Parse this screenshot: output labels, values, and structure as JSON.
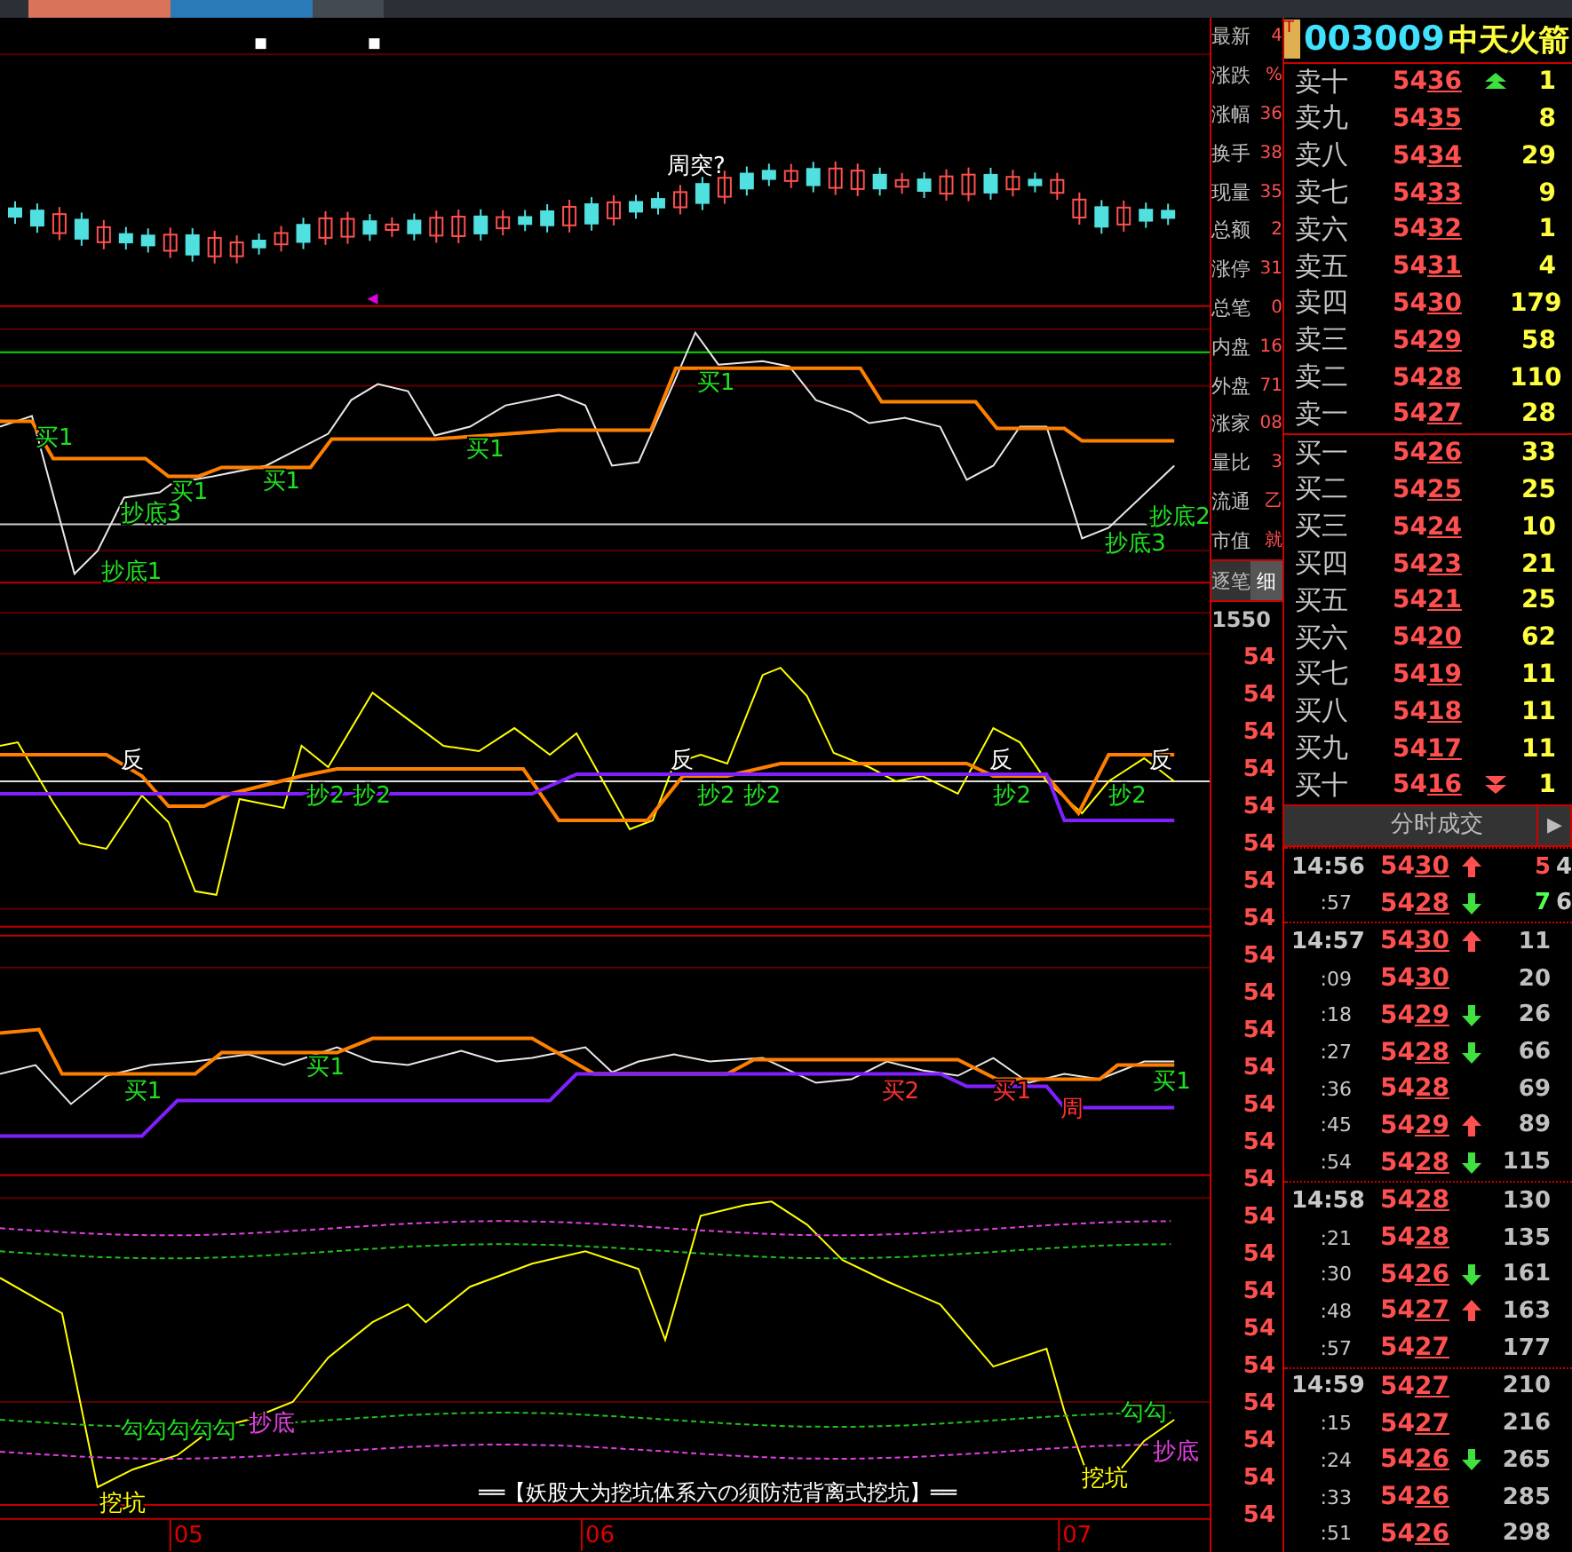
{
  "stock": {
    "badge": "T",
    "code": "003009",
    "name": "中天火箭"
  },
  "chart_panels": [
    {
      "labels": [
        {
          "text": "周突?",
          "kind": "note"
        }
      ]
    },
    {
      "labels": [
        {
          "text": "买1",
          "kind": "buy"
        },
        {
          "text": "买1",
          "kind": "buy"
        },
        {
          "text": "买1",
          "kind": "buy"
        },
        {
          "text": "买1",
          "kind": "buy"
        },
        {
          "text": "买1",
          "kind": "buy"
        },
        {
          "text": "抄底3",
          "kind": "buy"
        },
        {
          "text": "抄底1",
          "kind": "buy"
        },
        {
          "text": "抄底3",
          "kind": "buy"
        },
        {
          "text": "抄底2",
          "kind": "buy"
        }
      ]
    },
    {
      "labels": [
        {
          "text": "反",
          "kind": "note"
        },
        {
          "text": "抄2",
          "kind": "buy"
        },
        {
          "text": "抄2",
          "kind": "buy"
        },
        {
          "text": "反",
          "kind": "note"
        },
        {
          "text": "抄2",
          "kind": "buy"
        },
        {
          "text": "抄2",
          "kind": "buy"
        },
        {
          "text": "反",
          "kind": "note"
        },
        {
          "text": "抄2",
          "kind": "buy"
        },
        {
          "text": "抄2",
          "kind": "buy"
        },
        {
          "text": "反",
          "kind": "note"
        }
      ]
    },
    {
      "labels": [
        {
          "text": "买1",
          "kind": "buy"
        },
        {
          "text": "买1",
          "kind": "buy"
        },
        {
          "text": "买2",
          "kind": "sell"
        },
        {
          "text": "买1",
          "kind": "sell"
        },
        {
          "text": "周",
          "kind": "sell"
        },
        {
          "text": "买1",
          "kind": "buy"
        }
      ]
    },
    {
      "labels": [
        {
          "text": "勾勾勾勾勾",
          "kind": "buy"
        },
        {
          "text": "抄底",
          "kind": "magenta"
        },
        {
          "text": "挖坑",
          "kind": "dig"
        },
        {
          "text": "挖坑",
          "kind": "dig"
        },
        {
          "text": "勾勾",
          "kind": "buy"
        },
        {
          "text": "抄底",
          "kind": "magenta"
        }
      ],
      "caption": "══【妖股大为挖坑体系六の须防范背离式挖坑】══"
    }
  ],
  "x_axis": [
    "05",
    "06",
    "07"
  ],
  "info_column": [
    {
      "label": "最新",
      "value": "4"
    },
    {
      "label": "涨跌",
      "value": "%"
    },
    {
      "label": "涨幅",
      "value": "36"
    },
    {
      "label": "换手",
      "value": "38"
    },
    {
      "label": "现量",
      "value": "35"
    },
    {
      "label": "总额",
      "value": "2"
    },
    {
      "label": "涨停",
      "value": "31"
    },
    {
      "label": "总笔",
      "value": "0"
    },
    {
      "label": "内盘",
      "value": "16"
    },
    {
      "label": "外盘",
      "value": "71"
    },
    {
      "label": "涨家",
      "value": "08"
    },
    {
      "label": "量比",
      "value": "3"
    },
    {
      "label": "流通",
      "value": "乙"
    },
    {
      "label": "市值",
      "value": "就"
    }
  ],
  "info_tabs": [
    {
      "label": "逐笔",
      "selected": false
    },
    {
      "label": "细",
      "selected": true
    }
  ],
  "info_time": "1550",
  "info_prices": [
    "54",
    "54",
    "54",
    "54",
    "54",
    "54",
    "54",
    "54",
    "54",
    "54",
    "54",
    "54",
    "54",
    "54",
    "54",
    "54",
    "54",
    "54",
    "54",
    "54",
    "54",
    "54",
    "54",
    "54"
  ],
  "order_book": [
    {
      "label": "卖十",
      "price": "5436",
      "volume": "1",
      "arrow_up": true,
      "arrow_down": false
    },
    {
      "label": "卖九",
      "price": "5435",
      "volume": "8",
      "arrow_up": false,
      "arrow_down": false
    },
    {
      "label": "卖八",
      "price": "5434",
      "volume": "29",
      "arrow_up": false,
      "arrow_down": false
    },
    {
      "label": "卖七",
      "price": "5433",
      "volume": "9",
      "arrow_up": false,
      "arrow_down": false
    },
    {
      "label": "卖六",
      "price": "5432",
      "volume": "1",
      "arrow_up": false,
      "arrow_down": false
    },
    {
      "label": "卖五",
      "price": "5431",
      "volume": "4",
      "arrow_up": false,
      "arrow_down": false
    },
    {
      "label": "卖四",
      "price": "5430",
      "volume": "179",
      "arrow_up": false,
      "arrow_down": false
    },
    {
      "label": "卖三",
      "price": "5429",
      "volume": "58",
      "arrow_up": false,
      "arrow_down": false
    },
    {
      "label": "卖二",
      "price": "5428",
      "volume": "110",
      "arrow_up": false,
      "arrow_down": false
    },
    {
      "label": "卖一",
      "price": "5427",
      "volume": "28",
      "arrow_up": false,
      "arrow_down": false
    },
    {
      "label": "买一",
      "price": "5426",
      "volume": "33",
      "arrow_up": false,
      "arrow_down": false
    },
    {
      "label": "买二",
      "price": "5425",
      "volume": "25",
      "arrow_up": false,
      "arrow_down": false
    },
    {
      "label": "买三",
      "price": "5424",
      "volume": "10",
      "arrow_up": false,
      "arrow_down": false
    },
    {
      "label": "买四",
      "price": "5423",
      "volume": "21",
      "arrow_up": false,
      "arrow_down": false
    },
    {
      "label": "买五",
      "price": "5421",
      "volume": "25",
      "arrow_up": false,
      "arrow_down": false
    },
    {
      "label": "买六",
      "price": "5420",
      "volume": "62",
      "arrow_up": false,
      "arrow_down": false
    },
    {
      "label": "买七",
      "price": "5419",
      "volume": "11",
      "arrow_up": false,
      "arrow_down": false
    },
    {
      "label": "买八",
      "price": "5418",
      "volume": "11",
      "arrow_up": false,
      "arrow_down": false
    },
    {
      "label": "买九",
      "price": "5417",
      "volume": "11",
      "arrow_up": false,
      "arrow_down": false
    },
    {
      "label": "买十",
      "price": "5416",
      "volume": "1",
      "arrow_up": false,
      "arrow_down": true
    }
  ],
  "trades_header": {
    "title": "分时成交",
    "next": "▶"
  },
  "trades": [
    {
      "time": "14:56",
      "price": "5430",
      "arrow_up": true,
      "arrow_down": false,
      "volume": "5",
      "color": "#ff5050",
      "column_5": "4",
      "group_start": true
    },
    {
      "time": ":57",
      "price": "5428",
      "arrow_up": false,
      "arrow_down": true,
      "volume": "7",
      "color": "#50ff50",
      "column_5": "6",
      "group_start": false
    },
    {
      "time": "14:57",
      "price": "5430",
      "arrow_up": true,
      "arrow_down": false,
      "volume": "11",
      "color": "#c0c0c0",
      "group_start": true
    },
    {
      "time": ":09",
      "price": "5430",
      "arrow_up": false,
      "arrow_down": false,
      "volume": "20",
      "color": "#c0c0c0",
      "group_start": false
    },
    {
      "time": ":18",
      "price": "5429",
      "arrow_up": false,
      "arrow_down": true,
      "volume": "26",
      "color": "#c0c0c0",
      "group_start": false
    },
    {
      "time": ":27",
      "price": "5428",
      "arrow_up": false,
      "arrow_down": true,
      "volume": "66",
      "color": "#c0c0c0",
      "group_start": false
    },
    {
      "time": ":36",
      "price": "5428",
      "arrow_up": false,
      "arrow_down": false,
      "volume": "69",
      "color": "#c0c0c0",
      "group_start": false
    },
    {
      "time": ":45",
      "price": "5429",
      "arrow_up": true,
      "arrow_down": false,
      "volume": "89",
      "color": "#c0c0c0",
      "group_start": false
    },
    {
      "time": ":54",
      "price": "5428",
      "arrow_up": false,
      "arrow_down": true,
      "volume": "115",
      "color": "#c0c0c0",
      "group_start": false
    },
    {
      "time": "14:58",
      "price": "5428",
      "arrow_up": false,
      "arrow_down": false,
      "volume": "130",
      "color": "#c0c0c0",
      "group_start": true
    },
    {
      "time": ":21",
      "price": "5428",
      "arrow_up": false,
      "arrow_down": false,
      "volume": "135",
      "color": "#c0c0c0",
      "group_start": false
    },
    {
      "time": ":30",
      "price": "5426",
      "arrow_up": false,
      "arrow_down": true,
      "volume": "161",
      "color": "#c0c0c0",
      "group_start": false
    },
    {
      "time": ":48",
      "price": "5427",
      "arrow_up": true,
      "arrow_down": false,
      "volume": "163",
      "color": "#c0c0c0",
      "group_start": false
    },
    {
      "time": ":57",
      "price": "5427",
      "arrow_up": false,
      "arrow_down": false,
      "volume": "177",
      "color": "#c0c0c0",
      "group_start": false
    },
    {
      "time": "14:59",
      "price": "5427",
      "arrow_up": false,
      "arrow_down": false,
      "volume": "210",
      "color": "#c0c0c0",
      "group_start": true
    },
    {
      "time": ":15",
      "price": "5427",
      "arrow_up": false,
      "arrow_down": false,
      "volume": "216",
      "color": "#c0c0c0",
      "group_start": false
    },
    {
      "time": ":24",
      "price": "5426",
      "arrow_up": false,
      "arrow_down": true,
      "volume": "265",
      "color": "#c0c0c0",
      "group_start": false
    },
    {
      "time": ":33",
      "price": "5426",
      "arrow_up": false,
      "arrow_down": false,
      "volume": "285",
      "color": "#c0c0c0",
      "group_start": false
    },
    {
      "time": ":51",
      "price": "5426",
      "arrow_up": false,
      "arrow_down": false,
      "volume": "298",
      "color": "#c0c0c0",
      "group_start": false
    }
  ]
}
